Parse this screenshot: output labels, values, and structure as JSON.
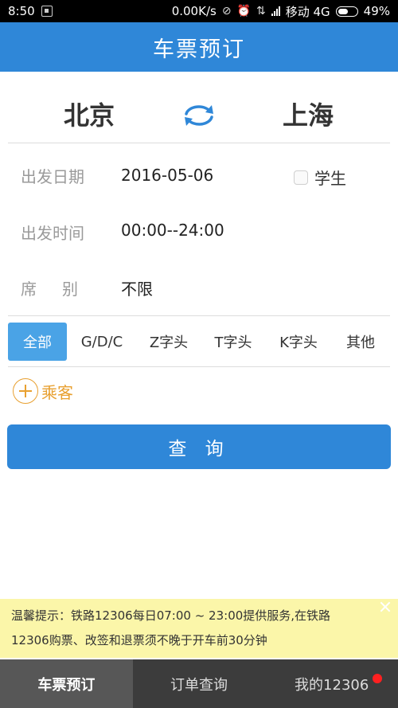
{
  "status_bar": {
    "time": "8:50",
    "net_speed": "0.00K/s",
    "carrier": "移动 4G",
    "battery": "49%",
    "battery_level": 0.49
  },
  "header": {
    "title": "车票预订"
  },
  "route": {
    "from": "北京",
    "to": "上海"
  },
  "form": {
    "date_label": "出发日期",
    "date_value": "2016-05-06",
    "student_label": "学生",
    "time_label": "出发时间",
    "time_value": "00:00--24:00",
    "seat_label": "席　别",
    "seat_value": "不限"
  },
  "train_filters": [
    "全部",
    "G/D/C",
    "Z字头",
    "T字头",
    "K字头",
    "其他"
  ],
  "passenger": {
    "label": "乘客"
  },
  "query_button": {
    "label": "查 询"
  },
  "notice": {
    "line1": "温馨提示：铁路12306每日07:00 ~ 23:00提供服务,在铁路",
    "line2": "12306购票、改签和退票须不晚于开车前30分钟"
  },
  "tabs": [
    "车票预订",
    "订单查询",
    "我的12306"
  ],
  "colors": {
    "primary": "#2f87d8",
    "chip_active": "#4aa3e6",
    "accent": "#e8a030",
    "notice_bg": "#fbf6a9",
    "tabbar_bg": "#3c3c3c"
  }
}
